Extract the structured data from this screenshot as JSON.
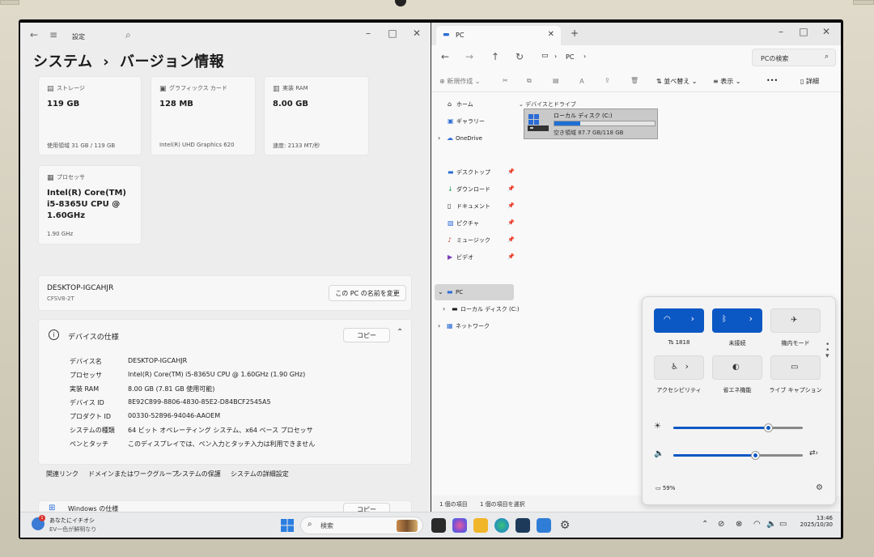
{
  "settings": {
    "app_label": "設定",
    "heading_parent": "システム",
    "heading_sep": "›",
    "heading_current": "バージョン情報",
    "cards": {
      "storage": {
        "title": "ストレージ",
        "value": "119 GB",
        "sub": "使用領域 31 GB / 119 GB"
      },
      "graphics": {
        "title": "グラフィックス カード",
        "value": "128 MB",
        "sub": "Intel(R) UHD Graphics 620"
      },
      "ram": {
        "title": "実装 RAM",
        "value": "8.00 GB",
        "sub": "速度: 2133 MT/秒"
      },
      "cpu": {
        "title": "プロセッサ",
        "value_line1": "Intel(R) Core(TM)",
        "value_line2": "i5-8365U CPU @",
        "value_line3": "1.60GHz",
        "sub": "1.90 GHz"
      }
    },
    "device_name": "DESKTOP-IGCAHJR",
    "device_model": "CFSV8-2T",
    "rename_button": "この PC の名前を変更",
    "spec_section": {
      "heading": "デバイスの仕様",
      "copy_button": "コピー",
      "rows": [
        {
          "k": "デバイス名",
          "v": "DESKTOP-IGCAHJR"
        },
        {
          "k": "プロセッサ",
          "v": "Intel(R) Core(TM) i5-8365U CPU @ 1.60GHz (1.90 GHz)"
        },
        {
          "k": "実装 RAM",
          "v": "8.00 GB (7.81 GB 使用可能)"
        },
        {
          "k": "デバイス ID",
          "v": "8E92C899-8806-4830-85E2-D84BCF2545A5"
        },
        {
          "k": "プロダクト ID",
          "v": "00330-52896-94046-AAOEM"
        },
        {
          "k": "システムの種類",
          "v": "64 ビット オペレーティング システム、x64 ベース プロセッサ"
        },
        {
          "k": "ペンとタッチ",
          "v": "このディスプレイでは、ペン入力とタッチ入力は利用できません"
        }
      ]
    },
    "related_links": {
      "label": "関連リンク",
      "domain": "ドメインまたはワークグループ",
      "protection": "システムの保護",
      "advanced": "システムの詳細設定"
    },
    "windows_spec": {
      "heading": "Windows の仕様",
      "copy_button": "コピー"
    }
  },
  "explorer": {
    "tab_title": "PC",
    "address": "PC",
    "search_placeholder": "PCの検索",
    "toolbar": {
      "new": "新規作成",
      "sort": "並べ替え",
      "view": "表示",
      "details": "詳細"
    },
    "sidebar": {
      "home": "ホーム",
      "gallery": "ギャラリー",
      "onedrive": "OneDrive",
      "desktop": "デスクトップ",
      "downloads": "ダウンロード",
      "documents": "ドキュメント",
      "pictures": "ピクチャ",
      "music": "ミュージック",
      "videos": "ビデオ",
      "pc": "PC",
      "local_disk": "ローカル ディスク (C:)",
      "network": "ネットワーク"
    },
    "group_label": "デバイスとドライブ",
    "drive": {
      "name": "ローカル ディスク (C:)",
      "free_text": "空き領域 87.7 GB/118 GB",
      "used_fraction": 0.26
    },
    "status": {
      "count": "1 個の項目",
      "selected": "1 個の項目を選択"
    }
  },
  "quick_settings": {
    "wifi_label": "Ts 1818",
    "bluetooth_label": "未接続",
    "airplane_label": "機内モード",
    "accessibility_label": "アクセシビリティ",
    "energy_label": "省エネ機能",
    "caption_label": "ライブ キャプション",
    "brightness_fraction": 0.74,
    "volume_fraction": 0.64,
    "battery_text": "59%"
  },
  "taskbar": {
    "news_title": "あなたにイチオシ",
    "news_sub": "EV一色が鮮明なり",
    "news_badge": "1",
    "search_placeholder": "検索",
    "time": "13:46",
    "date": "2025/10/30"
  }
}
